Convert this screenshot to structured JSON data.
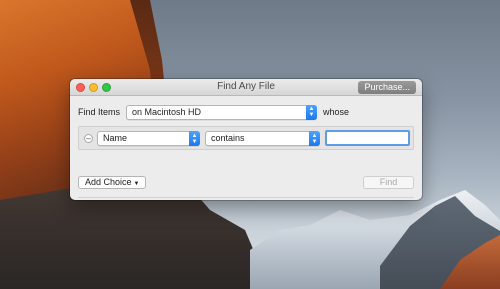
{
  "window": {
    "title": "Find Any File",
    "purchase_label": "Purchase..."
  },
  "search": {
    "find_items_label": "Find Items",
    "location_value": "on Macintosh HD",
    "whose_label": "whose"
  },
  "criteria": [
    {
      "field": "Name",
      "operator": "contains",
      "value": ""
    }
  ],
  "footer": {
    "add_choice_label": "Add Choice",
    "find_label": "Find"
  },
  "colors": {
    "accent": "#1a78f0",
    "close": "#fc5f57",
    "minimize": "#fdbc2e",
    "zoom": "#33c748"
  }
}
